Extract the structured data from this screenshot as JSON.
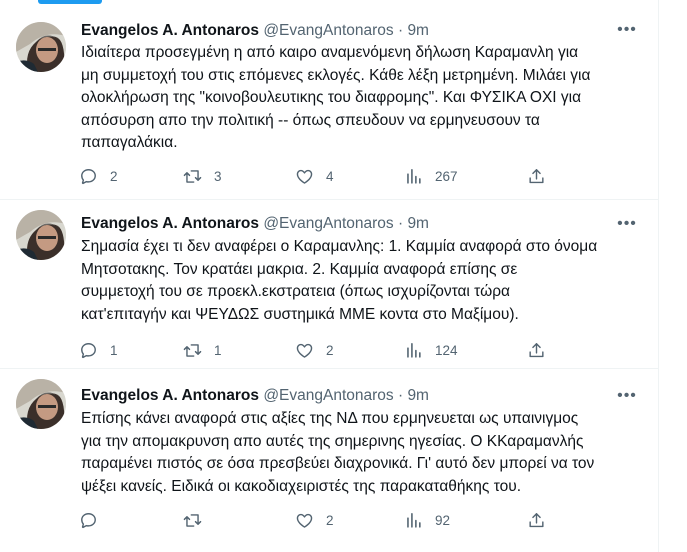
{
  "tweets": [
    {
      "name": "Evangelos A. Antonaros",
      "handle": "@EvangAntonaros",
      "time": "9m",
      "lines": [
        "Ιδιαίτερα προσεγμένη η από καιρο αναμενόμενη δήλωση Καραμανλη για",
        "μη συμμετοχή του στις επόμενες εκλογές. Κάθε λέξη μετρημένη. Μιλάει για",
        "ολοκλήρωση της \"κοινοβουλευτικης του διαφρομης\". Και ΦΥΣΙΚΑ ΟΧΙ για",
        "απόσυρση απο την πολιτική -- όπως σπευδουν να ερμηνευσουν τα",
        "παπαγαλάκια."
      ],
      "replies": "2",
      "retweets": "3",
      "likes": "4",
      "views": "267"
    },
    {
      "name": "Evangelos A. Antonaros",
      "handle": "@EvangAntonaros",
      "time": "9m",
      "lines": [
        "Σημασία έχει τι δεν αναφέρει ο Καραμανλης: 1. Καμμία αναφορά στο όνομα",
        "Μητσοτακης. Τον κρατάει μακρια. 2. Καμμία αναφορά επίσης σε",
        "συμμετοχή του σε προεκλ.εκστρατεια (όπως ισχυρίζονται τώρα",
        "κατ'επιταγήν και ΨΕΥΔΩΣ  συστημικά ΜΜΕ κοντα στο Μαξίμου)."
      ],
      "replies": "1",
      "retweets": "1",
      "likes": "2",
      "views": "124"
    },
    {
      "name": "Evangelos A. Antonaros",
      "handle": "@EvangAntonaros",
      "time": "9m",
      "lines": [
        "Επίσης κάνει αναφορά στις αξίες της ΝΔ που ερμηνευεται ως υπαινιγμος",
        "για την απομακρυνση απο αυτές της σημερινης ηγεσίας. Ο ΚΚαραμανλής",
        "παραμένει πιστός σε όσα πρεσβεύει διαχρονικά. Γι' αυτό δεν μπορεί να τον",
        "ψέξει κανείς. Ειδικά οι κακοδιαχειριστές της παρακαταθήκης του."
      ],
      "replies": "",
      "retweets": "",
      "likes": "2",
      "views": "92"
    }
  ],
  "ui": {
    "separator": " · ",
    "more_glyph": "•••",
    "icons": [
      "reply-icon",
      "retweet-icon",
      "like-icon",
      "views-icon",
      "share-icon"
    ],
    "colors": {
      "text": "#0f1419",
      "secondary": "#536471",
      "accent": "#1d9bf0",
      "border": "#eff3f4"
    }
  }
}
